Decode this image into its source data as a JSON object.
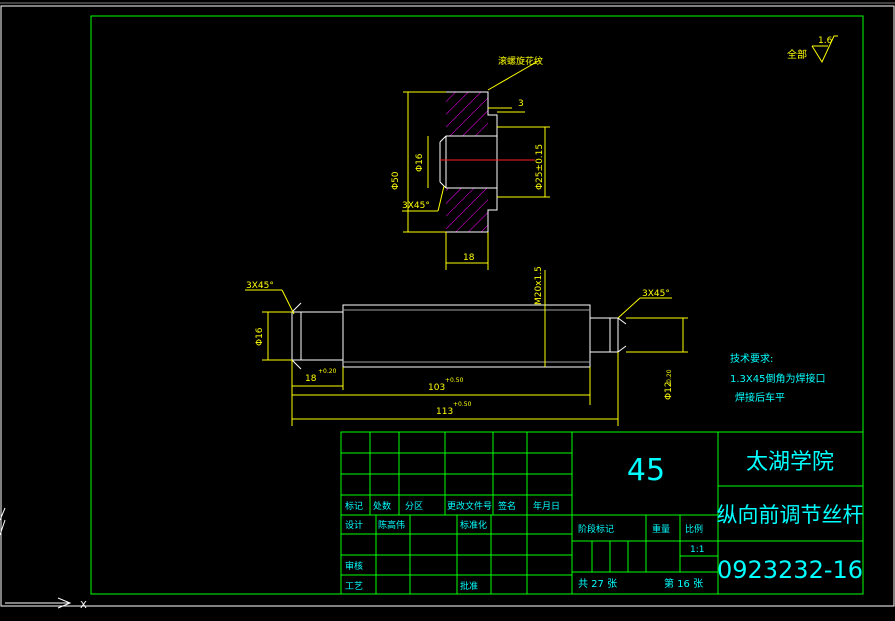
{
  "surface_finish": {
    "label": "全部",
    "value": "1.6"
  },
  "top_part": {
    "knurl_note": "滚螺旋花纹",
    "dim_outer": "Φ50",
    "dim_outer_tol": "0\n-0.20",
    "dim_inner": "Φ16",
    "dim_hole": "Φ25±0.15",
    "dim_chamfer": "3X45°",
    "dim_width": "18",
    "dim_step": "3"
  },
  "shaft": {
    "thread": "M20x1.5",
    "chamfer_left": "3X45°",
    "chamfer_right": "3X45°",
    "dia_left": "Φ16",
    "dia_right": "Φ12",
    "dia_right_tol": "-0.20",
    "len_left": "18",
    "len_left_tol": "+0.20",
    "len_mid": "103",
    "len_mid_tol": "+0.50",
    "len_total": "113",
    "len_total_tol": "+0.50"
  },
  "tech_requirements": {
    "title": "技术要求:",
    "line1": "1.3X45倒角为焊接口",
    "line2": "焊接后车平"
  },
  "title_block": {
    "material": "45",
    "school": "太湖学院",
    "part_name": "纵向前调节丝杆",
    "drawing_no": "0923232-16",
    "col_mark": "标记",
    "col_count": "处数",
    "col_zone": "分区",
    "col_doc": "更改文件号",
    "col_sign": "签名",
    "col_date": "年月日",
    "design_label": "设计",
    "designer": "陈高伟",
    "standard_label": "标准化",
    "review_label": "审核",
    "process_label": "工艺",
    "approve_label": "批准",
    "stage_label": "阶段标记",
    "weight_label": "重量",
    "scale_label": "比例",
    "scale": "1:1",
    "total_sheets": "共 27 张",
    "sheet_no": "第 16 张"
  },
  "colors": {
    "background": "#000000",
    "frame": "#00ff00",
    "dimension": "#ffff00",
    "outline": "#ffffff",
    "text": "#00ffff",
    "hatch": "#ff00ff",
    "centerline": "#ff2020"
  }
}
